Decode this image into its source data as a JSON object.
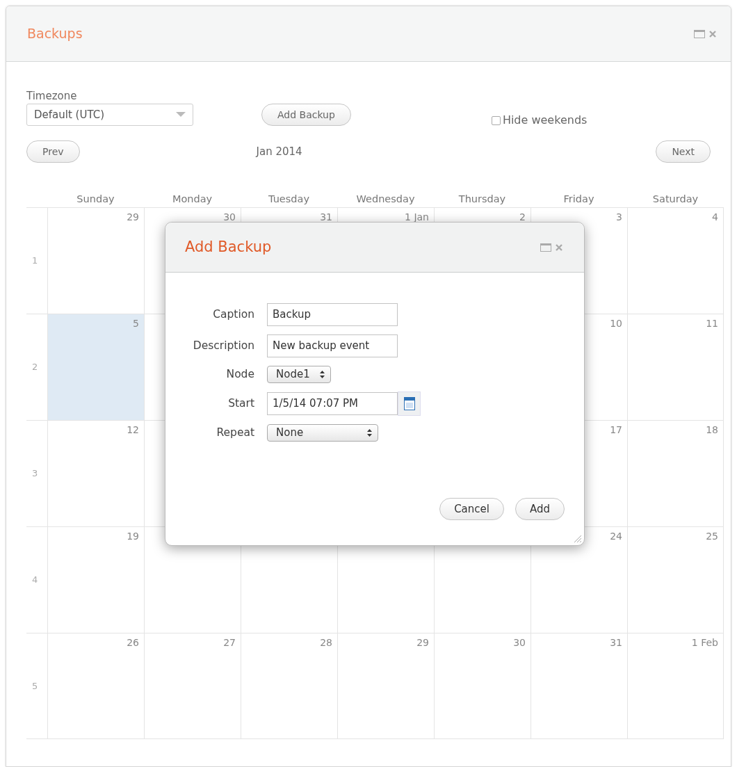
{
  "window": {
    "title": "Backups"
  },
  "toolbar": {
    "timezone_label": "Timezone",
    "timezone": "Default (UTC)",
    "add_button": "Add Backup",
    "hide_weekends": {
      "label": "Hide weekends",
      "checked": false
    }
  },
  "navigation": {
    "prev": "Prev",
    "month": "Jan 2014",
    "next": "Next"
  },
  "calendar": {
    "weekdays": [
      "Sunday",
      "Monday",
      "Tuesday",
      "Wednesday",
      "Thursday",
      "Friday",
      "Saturday"
    ],
    "weeks": [
      {
        "number": "1",
        "days": [
          {
            "day": "29",
            "selected": false
          },
          {
            "day": "30",
            "selected": false
          },
          {
            "day": "31",
            "selected": false
          },
          {
            "day": "1 Jan",
            "selected": false
          },
          {
            "day": "2",
            "selected": false
          },
          {
            "day": "3",
            "selected": false
          },
          {
            "day": "4",
            "selected": false
          }
        ]
      },
      {
        "number": "2",
        "days": [
          {
            "day": "5",
            "selected": true
          },
          {
            "selected": false
          }
        ],
        "trailing_days": [
          {
            "day": "10",
            "selected": false
          },
          {
            "day": "11",
            "selected": false
          }
        ]
      },
      {
        "number": "3",
        "days": [
          {
            "day": "12",
            "selected": false
          },
          {
            "selected": false
          }
        ],
        "trailing_days": [
          {
            "day": "17",
            "selected": false
          },
          {
            "day": "18",
            "selected": false
          }
        ]
      },
      {
        "number": "4",
        "days": [
          {
            "day": "19",
            "selected": false
          },
          {
            "selected": false
          },
          {
            "selected": false
          },
          {
            "selected": false
          },
          {
            "selected": false
          },
          {
            "day": "24",
            "selected": false
          },
          {
            "day": "25",
            "selected": false
          }
        ]
      },
      {
        "number": "5",
        "days": [
          {
            "day": "26",
            "selected": false
          },
          {
            "day": "27",
            "selected": false
          },
          {
            "day": "28",
            "selected": false
          },
          {
            "day": "29",
            "selected": false
          },
          {
            "day": "30",
            "selected": false
          },
          {
            "day": "31",
            "selected": false
          },
          {
            "day": "1 Feb",
            "selected": false
          }
        ]
      }
    ]
  },
  "dialog": {
    "title": "Add Backup",
    "fields": [
      {
        "kind": "text",
        "label": "Caption",
        "value": "Backup"
      },
      {
        "kind": "text",
        "label": "Description",
        "value": "New backup event"
      },
      {
        "kind": "select",
        "label": "Node",
        "value": "Node1"
      },
      {
        "kind": "date",
        "label": "Start",
        "value": "1/5/14 07:07 PM"
      },
      {
        "kind": "select",
        "label": "Repeat",
        "value": "None"
      }
    ],
    "buttons": [
      "Cancel",
      "Add"
    ]
  }
}
